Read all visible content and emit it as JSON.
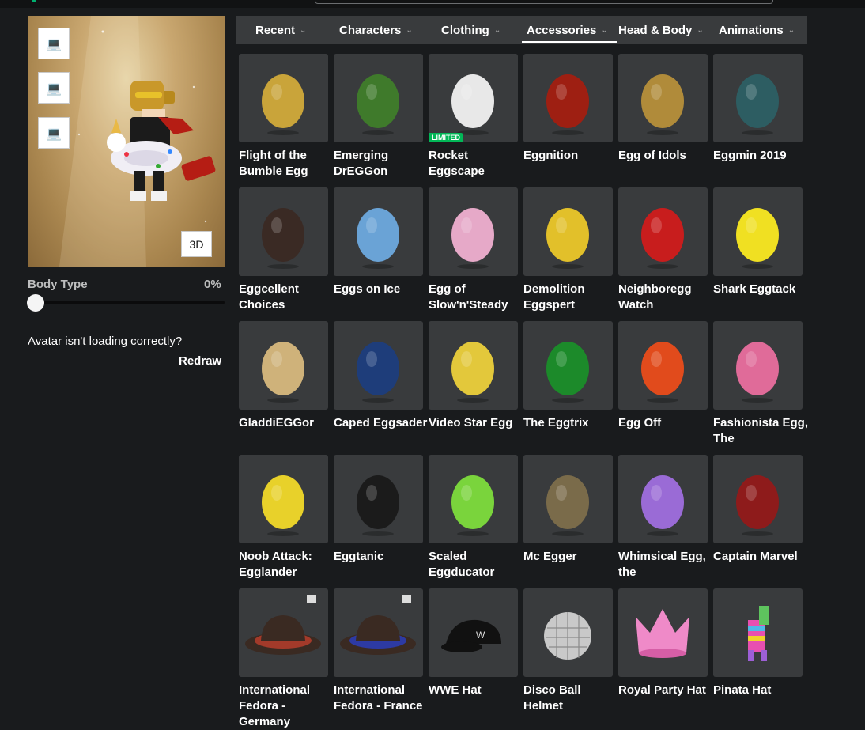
{
  "avatar": {
    "view_buttons": [
      {
        "name": "outfit-slot-1",
        "icon": "laptop-icon",
        "glyph": "💻"
      },
      {
        "name": "outfit-slot-2",
        "icon": "laptop-icon",
        "glyph": "💻"
      },
      {
        "name": "outfit-slot-3",
        "icon": "laptop-icon",
        "glyph": "💻"
      }
    ],
    "toggle_3d_label": "3D",
    "body_type_label": "Body Type",
    "body_type_value": "0%",
    "body_type_fraction": 0,
    "loading_message": "Avatar isn't loading correctly?",
    "redraw_label": "Redraw"
  },
  "tabs": [
    {
      "label": "Recent"
    },
    {
      "label": "Characters"
    },
    {
      "label": "Clothing"
    },
    {
      "label": "Accessories",
      "active": true
    },
    {
      "label": "Head & Body"
    },
    {
      "label": "Animations"
    }
  ],
  "items": [
    {
      "name": "Flight of the Bumble Egg",
      "icon": "bee-egg",
      "color": "#c9a43a"
    },
    {
      "name": "Emerging DrEGGon",
      "icon": "dragon-egg",
      "color": "#3f7a2b"
    },
    {
      "name": "Rocket Eggscape",
      "icon": "rocket-egg",
      "color": "#e8e8e8",
      "badge": "LIMITED"
    },
    {
      "name": "Eggnition",
      "icon": "mushroom-egg",
      "color": "#9e1f12"
    },
    {
      "name": "Egg of Idols",
      "icon": "idol-egg",
      "color": "#b08b3a"
    },
    {
      "name": "Eggmin 2019",
      "icon": "admin-egg",
      "color": "#2d5d62"
    },
    {
      "name": "Eggcellent Choices",
      "icon": "dark-egg",
      "color": "#3a2a24"
    },
    {
      "name": "Eggs on Ice",
      "icon": "ice-egg",
      "color": "#6aa3d6"
    },
    {
      "name": "Egg of Slow'n'Steady",
      "icon": "turtle-egg",
      "color": "#e6a9c8"
    },
    {
      "name": "Demolition Eggspert",
      "icon": "bomb-egg",
      "color": "#e2c02a"
    },
    {
      "name": "Neighboregg Watch",
      "icon": "masked-egg",
      "color": "#c81d1d"
    },
    {
      "name": "Shark Eggtack",
      "icon": "floatie-egg",
      "color": "#f0e022"
    },
    {
      "name": "GladdiEGGor",
      "icon": "gladiator-egg",
      "color": "#cfb27a"
    },
    {
      "name": "Caped Eggsader",
      "icon": "caped-egg",
      "color": "#1e3d7a"
    },
    {
      "name": "Video Star Egg",
      "icon": "headphone-egg",
      "color": "#e3c83b"
    },
    {
      "name": "The Eggtrix",
      "icon": "matrix-egg",
      "color": "#1c8a2a"
    },
    {
      "name": "Egg Off",
      "icon": "angry-egg",
      "color": "#e14b1c"
    },
    {
      "name": "Fashionista Egg, The",
      "icon": "fashion-egg",
      "color": "#e06b99"
    },
    {
      "name": "Noob Attack: Egglander",
      "icon": "noob-egg",
      "color": "#e8d12a"
    },
    {
      "name": "Eggtanic",
      "icon": "ship-egg",
      "color": "#1b1b1b"
    },
    {
      "name": "Scaled Eggducator",
      "icon": "lizard-egg",
      "color": "#7ad43c"
    },
    {
      "name": "Mc Egger",
      "icon": "armor-egg",
      "color": "#7a6b4a"
    },
    {
      "name": "Whimsical Egg, the",
      "icon": "winged-egg",
      "color": "#9a6bd6"
    },
    {
      "name": "Captain Marvel",
      "icon": "helmet-egg",
      "color": "#8e1b1b"
    },
    {
      "name": "International Fedora - Germany",
      "icon": "fedora-de",
      "color": "#a33a2a"
    },
    {
      "name": "International Fedora - France",
      "icon": "fedora-fr",
      "color": "#2d3aa3"
    },
    {
      "name": "WWE Hat",
      "icon": "cap-hat",
      "color": "#101010"
    },
    {
      "name": "Disco Ball Helmet",
      "icon": "disco-ball",
      "color": "#c9c9c9"
    },
    {
      "name": "Royal Party Hat",
      "icon": "crown-hat",
      "color": "#ef8ac8"
    },
    {
      "name": "Pinata Hat",
      "icon": "pinata-hat",
      "color": "#e84fb0"
    }
  ]
}
